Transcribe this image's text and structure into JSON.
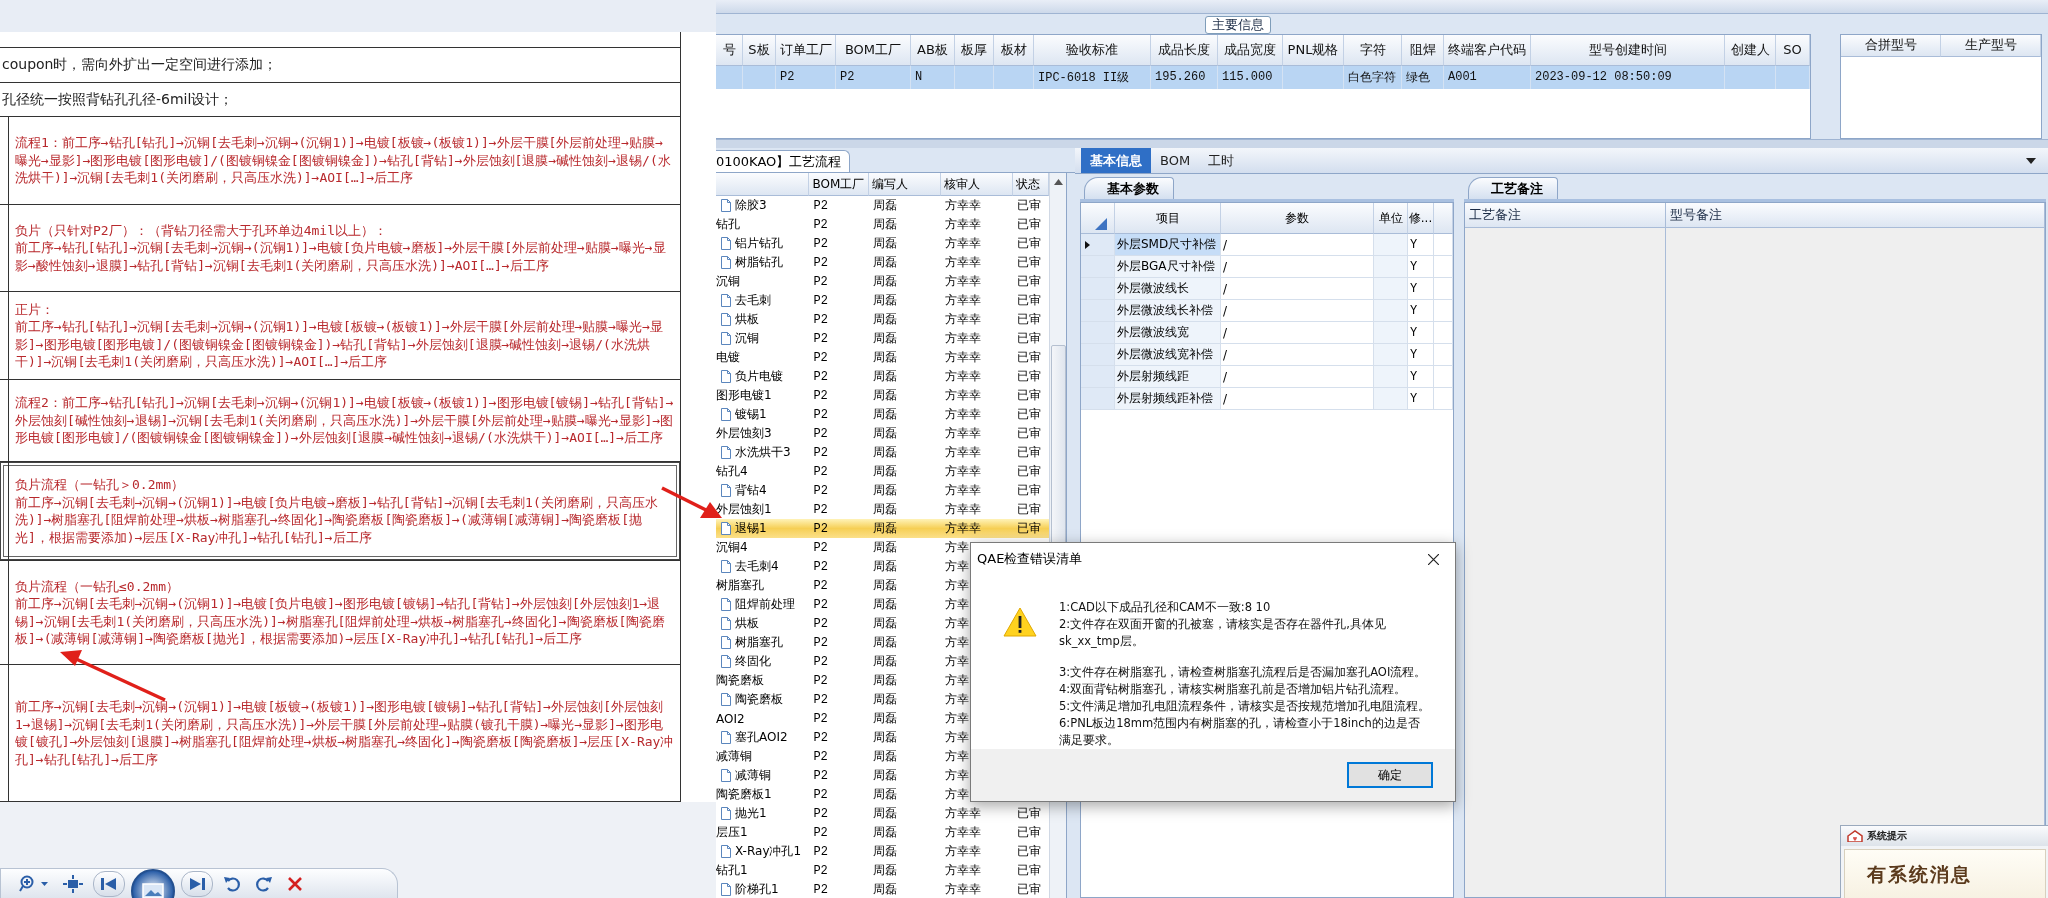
{
  "viewer": {
    "rows": [
      {
        "kind": "plain",
        "text": "coupon时，需向外扩出一定空间进行添加；"
      },
      {
        "kind": "plain",
        "text": "孔径统一按照背钻孔孔径-6mil设计；"
      },
      {
        "kind": "flow",
        "body": "流程1：前工序→钻孔[钻孔]→沉铜[去毛刺→沉铜→(沉铜1)]→电镀[板镀→(板镀1)]→外层干膜[外层前处理→贴膜→曝光→显影]→图形电镀[图形电镀]/(图镀铜镍金[图镀铜镍金])→钻孔[背钻]→外层蚀刻[退膜→碱性蚀刻→退锡/(水洗烘干)]→沉铜[去毛刺1(关闭磨刷，只高压水洗)]→AOI[…]→后工序",
        "selected": false
      },
      {
        "kind": "flow",
        "heading": "负片（只针对P2厂）：（背钻刀径需大于孔环单边4mil以上）：",
        "body": "前工序→钻孔[钻孔]→沉铜[去毛刺→沉铜→(沉铜1)]→电镀[负片电镀→磨板]→外层干膜[外层前处理→贴膜→曝光→显影→酸性蚀刻→退膜]→钻孔[背钻]→沉铜[去毛刺1(关闭磨刷，只高压水洗)]→AOI[…]→后工序",
        "selected": false
      },
      {
        "kind": "flow",
        "heading": "正片：",
        "body": "前工序→钻孔[钻孔]→沉铜[去毛刺→沉铜→(沉铜1)]→电镀[板镀→(板镀1)]→外层干膜[外层前处理→贴膜→曝光→显影]→图形电镀[图形电镀]/(图镀铜镍金[图镀铜镍金])→钻孔[背钻]→外层蚀刻[退膜→碱性蚀刻→退锡/(水洗烘干)]→沉铜[去毛刺1(关闭磨刷，只高压水洗)]→AOI[…]→后工序",
        "selected": false
      },
      {
        "kind": "flow",
        "body": "流程2：前工序→钻孔[钻孔]→沉铜[去毛刺→沉铜→(沉铜1)]→电镀[板镀→(板镀1)]→图形电镀[镀锡]→钻孔[背钻]→外层蚀刻[碱性蚀刻→退锡]→沉铜[去毛刺1(关闭磨刷，只高压水洗)]→外层干膜[外层前处理→贴膜→曝光→显影]→图形电镀[图形电镀]/(图镀铜镍金[图镀铜镍金])→外层蚀刻[退膜→碱性蚀刻→退锡/(水洗烘干)]→AOI[…]→后工序",
        "selected": false
      },
      {
        "kind": "flow",
        "heading": "负片流程（一钻孔＞0.2mm）",
        "body": "前工序→沉铜[去毛刺→沉铜→(沉铜1)]→电镀[负片电镀→磨板]→钻孔[背钻]→沉铜[去毛刺1(关闭磨刷，只高压水洗)]→树脂塞孔[阻焊前处理→烘板→树脂塞孔→终固化]→陶瓷磨板[陶瓷磨板]→(减薄铜[减薄铜]→陶瓷磨板[抛光]，根据需要添加)→层压[X-Ray冲孔]→钻孔[钻孔]→后工序",
        "selected": true
      },
      {
        "kind": "flow",
        "heading": "负片流程（一钻孔≤0.2mm）",
        "body": "前工序→沉铜[去毛刺→沉铜→(沉铜1)]→电镀[负片电镀]→图形电镀[镀锡]→钻孔[背钻]→外层蚀刻[外层蚀刻1→退锡]→沉铜[去毛刺1(关闭磨刷，只高压水洗)]→树脂塞孔[阻焊前处理→烘板→树脂塞孔→终固化]→陶瓷磨板[陶瓷磨板]→(减薄铜[减薄铜]→陶瓷磨板[抛光]，根据需要添加)→层压[X-Ray冲孔]→钻孔[钻孔]→后工序",
        "selected": false
      },
      {
        "kind": "flow",
        "body": "前工序→沉铜[去毛刺→沉铜→(沉铜1)]→电镀[板镀→(板镀1)]→图形电镀[镀锡]→钻孔[背钻]→外层蚀刻[外层蚀刻1→退锡]→沉铜[去毛刺1(关闭磨刷，只高压水洗)]→外层干膜[外层前处理→贴膜(镀孔干膜)→曝光→显影]→图形电镀[镀孔]→外层蚀刻[退膜]→树脂塞孔[阻焊前处理→烘板→树脂塞孔→终固化]→陶瓷磨板[陶瓷磨板]→层压[X-Ray冲孔]→钻孔[钻孔]→后工序",
        "selected": false
      }
    ]
  },
  "main_info": {
    "title": "主要信息",
    "columns": [
      {
        "label": "号"
      },
      {
        "label": "S板"
      },
      {
        "label": "订单工厂",
        "value": "P2"
      },
      {
        "label": "BOM工厂",
        "value": "P2"
      },
      {
        "label": "AB板",
        "value": "N"
      },
      {
        "label": "板厚"
      },
      {
        "label": "板材"
      },
      {
        "label": "验收标准",
        "value": "IPC-6018 II级"
      },
      {
        "label": "成品长度",
        "value": "195.260"
      },
      {
        "label": "成品宽度",
        "value": "115.000"
      },
      {
        "label": "PNL规格"
      },
      {
        "label": "字符",
        "value": "白色字符"
      },
      {
        "label": "阻焊",
        "value": "绿色"
      },
      {
        "label": "终端客户代码",
        "value": "A001"
      },
      {
        "label": "型号创建时间",
        "value": "2023-09-12 08:50:09"
      },
      {
        "label": "创建人"
      },
      {
        "label": "SO"
      }
    ],
    "side_columns": [
      "合拼型号",
      "生产型号"
    ]
  },
  "process_flow": {
    "tab": "0100KAO】工艺流程",
    "columns": [
      "BOM工厂",
      "编写人",
      "核审人",
      "状态"
    ],
    "nodes": [
      {
        "kind": "step",
        "name": "除胶3",
        "bom_factory": "P2",
        "writer": "周磊",
        "reviewer": "方幸幸",
        "status": "已审",
        "selected": false
      },
      {
        "kind": "group",
        "name": "钻孔",
        "bom_factory": "P2",
        "writer": "周磊",
        "reviewer": "方幸幸",
        "status": "已审",
        "selected": false,
        "children": [
          {
            "kind": "step",
            "name": "铝片钻孔",
            "bom_factory": "P2",
            "writer": "周磊",
            "reviewer": "方幸幸",
            "status": "已审",
            "selected": false
          },
          {
            "kind": "step",
            "name": "树脂钻孔",
            "bom_factory": "P2",
            "writer": "周磊",
            "reviewer": "方幸幸",
            "status": "已审",
            "selected": false
          }
        ]
      },
      {
        "kind": "group",
        "name": "沉铜",
        "bom_factory": "P2",
        "writer": "周磊",
        "reviewer": "方幸幸",
        "status": "已审",
        "selected": false,
        "children": [
          {
            "kind": "step",
            "name": "去毛刺",
            "bom_factory": "P2",
            "writer": "周磊",
            "reviewer": "方幸幸",
            "status": "已审",
            "selected": false
          },
          {
            "kind": "step",
            "name": "烘板",
            "bom_factory": "P2",
            "writer": "周磊",
            "reviewer": "方幸幸",
            "status": "已审",
            "selected": false
          },
          {
            "kind": "step",
            "name": "沉铜",
            "bom_factory": "P2",
            "writer": "周磊",
            "reviewer": "方幸幸",
            "status": "已审",
            "selected": false
          }
        ]
      },
      {
        "kind": "group",
        "name": "电镀",
        "bom_factory": "P2",
        "writer": "周磊",
        "reviewer": "方幸幸",
        "status": "已审",
        "selected": false,
        "children": [
          {
            "kind": "step",
            "name": "负片电镀",
            "bom_factory": "P2",
            "writer": "周磊",
            "reviewer": "方幸幸",
            "status": "已审",
            "selected": false
          }
        ]
      },
      {
        "kind": "group",
        "name": "图形电镀1",
        "bom_factory": "P2",
        "writer": "周磊",
        "reviewer": "方幸幸",
        "status": "已审",
        "selected": false,
        "children": [
          {
            "kind": "step",
            "name": "镀锡1",
            "bom_factory": "P2",
            "writer": "周磊",
            "reviewer": "方幸幸",
            "status": "已审",
            "selected": false
          }
        ]
      },
      {
        "kind": "group",
        "name": "外层蚀刻3",
        "bom_factory": "P2",
        "writer": "周磊",
        "reviewer": "方幸幸",
        "status": "已审",
        "selected": false,
        "children": [
          {
            "kind": "step",
            "name": "水洗烘干3",
            "bom_factory": "P2",
            "writer": "周磊",
            "reviewer": "方幸幸",
            "status": "已审",
            "selected": false
          }
        ]
      },
      {
        "kind": "group",
        "name": "钻孔4",
        "bom_factory": "P2",
        "writer": "周磊",
        "reviewer": "方幸幸",
        "status": "已审",
        "selected": false,
        "children": [
          {
            "kind": "step",
            "name": "背钻4",
            "bom_factory": "P2",
            "writer": "周磊",
            "reviewer": "方幸幸",
            "status": "已审",
            "selected": false
          }
        ]
      },
      {
        "kind": "group",
        "name": "外层蚀刻1",
        "bom_factory": "P2",
        "writer": "周磊",
        "reviewer": "方幸幸",
        "status": "已审",
        "selected": false,
        "children": [
          {
            "kind": "step",
            "name": "退锡1",
            "bom_factory": "P2",
            "writer": "周磊",
            "reviewer": "方幸幸",
            "status": "已审",
            "selected": true
          }
        ]
      },
      {
        "kind": "group",
        "name": "沉铜4",
        "bom_factory": "P2",
        "writer": "周磊",
        "reviewer": "方幸",
        "selected": false,
        "children": [
          {
            "kind": "step",
            "name": "去毛刺4",
            "bom_factory": "P2",
            "writer": "周磊",
            "reviewer": "方幸",
            "selected": false
          }
        ]
      },
      {
        "kind": "group",
        "name": "树脂塞孔",
        "bom_factory": "P2",
        "writer": "周磊",
        "reviewer": "方幸",
        "selected": false,
        "children": [
          {
            "kind": "step",
            "name": "阻焊前处理",
            "bom_factory": "P2",
            "writer": "周磊",
            "reviewer": "方幸",
            "selected": false
          },
          {
            "kind": "step",
            "name": "烘板",
            "bom_factory": "P2",
            "writer": "周磊",
            "reviewer": "方幸",
            "selected": false
          },
          {
            "kind": "step",
            "name": "树脂塞孔",
            "bom_factory": "P2",
            "writer": "周磊",
            "reviewer": "方幸",
            "selected": false
          },
          {
            "kind": "step",
            "name": "终固化",
            "bom_factory": "P2",
            "writer": "周磊",
            "reviewer": "方幸",
            "selected": false
          }
        ]
      },
      {
        "kind": "group",
        "name": "陶瓷磨板",
        "bom_factory": "P2",
        "writer": "周磊",
        "reviewer": "方幸",
        "selected": false,
        "children": [
          {
            "kind": "step",
            "name": "陶瓷磨板",
            "bom_factory": "P2",
            "writer": "周磊",
            "reviewer": "方幸",
            "selected": false
          }
        ]
      },
      {
        "kind": "group",
        "name": "AOI2",
        "bom_factory": "P2",
        "writer": "周磊",
        "reviewer": "方幸",
        "selected": false,
        "children": [
          {
            "kind": "step",
            "name": "塞孔AOI2",
            "bom_factory": "P2",
            "writer": "周磊",
            "reviewer": "方幸",
            "selected": false
          }
        ]
      },
      {
        "kind": "group",
        "name": "减薄铜",
        "bom_factory": "P2",
        "writer": "周磊",
        "reviewer": "方幸",
        "selected": false,
        "children": [
          {
            "kind": "step",
            "name": "减薄铜",
            "bom_factory": "P2",
            "writer": "周磊",
            "reviewer": "方幸",
            "selected": false
          }
        ]
      },
      {
        "kind": "group",
        "name": "陶瓷磨板1",
        "bom_factory": "P2",
        "writer": "周磊",
        "reviewer": "方幸",
        "selected": false,
        "children": [
          {
            "kind": "step",
            "name": "抛光1",
            "bom_factory": "P2",
            "writer": "周磊",
            "reviewer": "方幸幸",
            "status": "已审",
            "selected": false
          }
        ]
      },
      {
        "kind": "group",
        "name": "层压1",
        "bom_factory": "P2",
        "writer": "周磊",
        "reviewer": "方幸幸",
        "status": "已审",
        "selected": false,
        "children": [
          {
            "kind": "step",
            "name": "X-Ray冲孔1",
            "bom_factory": "P2",
            "writer": "周磊",
            "reviewer": "方幸幸",
            "status": "已审",
            "selected": false
          }
        ]
      },
      {
        "kind": "group",
        "name": "钻孔1",
        "bom_factory": "P2",
        "writer": "周磊",
        "reviewer": "方幸幸",
        "status": "已审",
        "selected": false,
        "children": [
          {
            "kind": "step",
            "name": "阶梯孔1",
            "bom_factory": "P2",
            "writer": "周磊",
            "reviewer": "方幸幸",
            "status": "已审",
            "selected": false
          }
        ]
      }
    ]
  },
  "info_panel": {
    "tabs": [
      {
        "label": "基本信息",
        "selected": true
      },
      {
        "label": "BOM",
        "selected": false
      },
      {
        "label": "工时",
        "selected": false
      }
    ],
    "params": {
      "tab": "基本参数",
      "columns": [
        "项目",
        "参数",
        "单位",
        "修..."
      ],
      "rows": [
        {
          "item": "外层SMD尺寸补偿",
          "value": "/",
          "flag": "Y",
          "current": true
        },
        {
          "item": "外层BGA尺寸补偿",
          "value": "/",
          "flag": "Y",
          "current": false
        },
        {
          "item": "外层微波线长",
          "value": "/",
          "flag": "Y",
          "current": false
        },
        {
          "item": "外层微波线长补偿",
          "value": "/",
          "flag": "Y",
          "current": false
        },
        {
          "item": "外层微波线宽",
          "value": "/",
          "flag": "Y",
          "current": false
        },
        {
          "item": "外层微波线宽补偿",
          "value": "/",
          "flag": "Y",
          "current": false
        },
        {
          "item": "外层射频线距",
          "value": "/",
          "flag": "Y",
          "current": false
        },
        {
          "item": "外层射频线距补偿",
          "value": "/",
          "flag": "Y",
          "current": false
        }
      ]
    },
    "remarks": {
      "tab": "工艺备注",
      "columns": [
        "工艺备注",
        "型号备注"
      ]
    }
  },
  "dialog": {
    "title": "QAE检查错误清单",
    "messages": [
      [
        "1:CAD以下成品孔径和CAM不一致:8 10",
        "2:文件存在双面开窗的孔被塞，请核实是否存在器件孔,具体见sk_xx_tmp层。"
      ],
      [
        "3:文件存在树脂塞孔，请检查树脂塞孔流程后是否漏加塞孔AOI流程。",
        "4:双面背钻树脂塞孔，请核实树脂塞孔前是否增加铝片钻孔流程。",
        "5:文件满足增加孔电阻流程条件，请核实是否按规范增加孔电阻流程。",
        "6:PNL板边18mm范围内有树脂塞的孔，请检查小于18inch的边是否满足要求。"
      ]
    ],
    "button": "确定"
  },
  "notification": {
    "title": "系统提示",
    "message": "有系统消息"
  }
}
